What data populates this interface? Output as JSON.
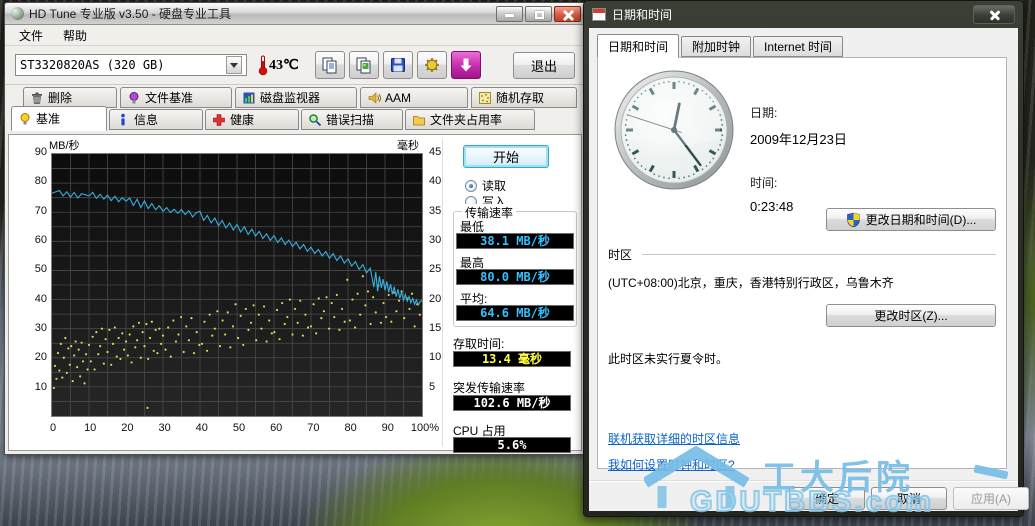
{
  "hdtune": {
    "title": "HD Tune 专业版 v3.50 - 硬盘专业工具",
    "menu": [
      "文件",
      "帮助"
    ],
    "drive_select": "ST3320820AS (320 GB)",
    "temperature": "43℃",
    "toolbar_icons": [
      "copy-text-icon",
      "copy-image-icon",
      "save-icon",
      "options-icon",
      "download-arrow-icon"
    ],
    "exit_label": "退出",
    "tabs_row1": [
      {
        "label": "删除",
        "icon": "trash-icon"
      },
      {
        "label": "文件基准",
        "icon": "purple-bulb-icon"
      },
      {
        "label": "磁盘监视器",
        "icon": "monitor-chart-icon"
      },
      {
        "label": "AAM",
        "icon": "speaker-icon"
      },
      {
        "label": "随机存取",
        "icon": "random-access-icon"
      }
    ],
    "tabs_row2": [
      {
        "label": "基准",
        "icon": "yellow-bulb-icon",
        "active": true
      },
      {
        "label": "信息",
        "icon": "info-icon"
      },
      {
        "label": "健康",
        "icon": "health-cross-icon"
      },
      {
        "label": "错误扫描",
        "icon": "magnifier-icon"
      },
      {
        "label": "文件夹占用率",
        "icon": "folder-icon"
      }
    ],
    "start_button": "开始",
    "radio_read": "读取",
    "radio_write": "写入",
    "transfer_group": {
      "title": "传输速率",
      "min_label": "最低",
      "min_value": "38.1 MB/秒",
      "max_label": "最高",
      "max_value": "80.0 MB/秒",
      "avg_label": "平均:",
      "avg_value": "64.6 MB/秒"
    },
    "access_label": "存取时间:",
    "access_value": "13.4 毫秒",
    "burst_label": "突发传输速率",
    "burst_value": "102.6 MB/秒",
    "cpu_label": "CPU 占用",
    "cpu_value": "5.6%"
  },
  "chart_data": {
    "type": "line+scatter",
    "ylabel_left": "MB/秒",
    "ylabel_right": "毫秒",
    "ylim_left": [
      0,
      90
    ],
    "ylim_right": [
      0,
      45
    ],
    "xlim": [
      0,
      100
    ],
    "grid": true,
    "y_left_ticks": [
      90,
      80,
      70,
      60,
      50,
      40,
      30,
      20,
      10
    ],
    "y_right_ticks": [
      45,
      40,
      35,
      30,
      25,
      20,
      15,
      10,
      5
    ],
    "x_tick_labels": [
      "0",
      "10",
      "20",
      "30",
      "40",
      "50",
      "60",
      "70",
      "80",
      "90",
      "100%"
    ],
    "line_color": "#3aaede",
    "scatter_color": "#d8d858",
    "series": [
      {
        "name": "transfer_rate_MBps",
        "points": [
          [
            0,
            76.5
          ],
          [
            2,
            77.5
          ],
          [
            3,
            75.6
          ],
          [
            4,
            77.0
          ],
          [
            5,
            75.2
          ],
          [
            6,
            76.8
          ],
          [
            7,
            74.9
          ],
          [
            8,
            76.4
          ],
          [
            10,
            75.6
          ],
          [
            11,
            76.8
          ],
          [
            12,
            74.8
          ],
          [
            13,
            76.2
          ],
          [
            14,
            74.5
          ],
          [
            15,
            75.9
          ],
          [
            16,
            74.0
          ],
          [
            17,
            75.5
          ],
          [
            18,
            73.6
          ],
          [
            19,
            75.0
          ],
          [
            20,
            73.8
          ],
          [
            21,
            74.9
          ],
          [
            22,
            72.3
          ],
          [
            23,
            74.5
          ],
          [
            24,
            71.6
          ],
          [
            25,
            73.9
          ],
          [
            26,
            71.2
          ],
          [
            27,
            73.0
          ],
          [
            28,
            70.8
          ],
          [
            29,
            72.2
          ],
          [
            30,
            70.3
          ],
          [
            31,
            71.6
          ],
          [
            32,
            69.9
          ],
          [
            33,
            71.0
          ],
          [
            34,
            69.6
          ],
          [
            35,
            70.9
          ],
          [
            36,
            69.2
          ],
          [
            37,
            70.5
          ],
          [
            38,
            68.4
          ],
          [
            39,
            69.9
          ],
          [
            40,
            70.3
          ],
          [
            41,
            67.2
          ],
          [
            42,
            68.9
          ],
          [
            43,
            66.3
          ],
          [
            44,
            68.0
          ],
          [
            45,
            65.4
          ],
          [
            46,
            67.2
          ],
          [
            47,
            64.6
          ],
          [
            48,
            66.3
          ],
          [
            49,
            63.9
          ],
          [
            50,
            65.8
          ],
          [
            51,
            63.2
          ],
          [
            52,
            65.0
          ],
          [
            53,
            62.4
          ],
          [
            54,
            64.2
          ],
          [
            55,
            61.8
          ],
          [
            56,
            63.4
          ],
          [
            57,
            61.0
          ],
          [
            58,
            62.6
          ],
          [
            59,
            60.3
          ],
          [
            60,
            62.0
          ],
          [
            61,
            59.6
          ],
          [
            62,
            61.2
          ],
          [
            63,
            58.9
          ],
          [
            64,
            60.4
          ],
          [
            65,
            58.2
          ],
          [
            66,
            59.7
          ],
          [
            67,
            57.4
          ],
          [
            68,
            58.9
          ],
          [
            69,
            56.6
          ],
          [
            70,
            58.0
          ],
          [
            71,
            55.8
          ],
          [
            72,
            57.2
          ],
          [
            73,
            55.0
          ],
          [
            74,
            56.5
          ],
          [
            75,
            54.2
          ],
          [
            76,
            55.8
          ],
          [
            77,
            53.4
          ],
          [
            78,
            55.0
          ],
          [
            79,
            52.5
          ],
          [
            80,
            54.0
          ],
          [
            81,
            51.5
          ],
          [
            82,
            53.0
          ],
          [
            83,
            50.4
          ],
          [
            84,
            52.0
          ],
          [
            85,
            49.2
          ],
          [
            86,
            50.8
          ],
          [
            87,
            44.3
          ],
          [
            87.5,
            49.5
          ],
          [
            88,
            42.8
          ],
          [
            88.5,
            48.0
          ],
          [
            89,
            44.0
          ],
          [
            89.5,
            47.0
          ],
          [
            90,
            43.2
          ],
          [
            90.5,
            46.2
          ],
          [
            91,
            42.5
          ],
          [
            91.5,
            45.3
          ],
          [
            92,
            41.8
          ],
          [
            92.5,
            44.4
          ],
          [
            93,
            41.0
          ],
          [
            93.5,
            43.5
          ],
          [
            94,
            40.4
          ],
          [
            94.5,
            42.6
          ],
          [
            95,
            39.8
          ],
          [
            95.5,
            41.8
          ],
          [
            96,
            39.4
          ],
          [
            96.5,
            41.0
          ],
          [
            97,
            38.9
          ],
          [
            97.5,
            40.4
          ],
          [
            98,
            38.4
          ],
          [
            98.5,
            39.9
          ],
          [
            99,
            38.1
          ],
          [
            99.5,
            39.3
          ],
          [
            100,
            39.6
          ]
        ]
      },
      {
        "name": "access_time_ms",
        "points": [
          [
            0.5,
            4.8
          ],
          [
            0.8,
            8.6
          ],
          [
            1.2,
            6.4
          ],
          [
            1.6,
            10.8
          ],
          [
            2.0,
            7.8
          ],
          [
            2.4,
            12.4
          ],
          [
            2.8,
            6.6
          ],
          [
            3.2,
            10.0
          ],
          [
            3.6,
            13.4
          ],
          [
            4.0,
            7.4
          ],
          [
            4.4,
            11.6
          ],
          [
            4.8,
            8.8
          ],
          [
            5.2,
            12.0
          ],
          [
            5.6,
            6.0
          ],
          [
            6.0,
            10.4
          ],
          [
            6.4,
            12.8
          ],
          [
            6.8,
            8.4
          ],
          [
            7.2,
            11.4
          ],
          [
            7.6,
            6.8
          ],
          [
            8.0,
            12.6
          ],
          [
            8.4,
            9.4
          ],
          [
            8.8,
            5.6
          ],
          [
            9.2,
            10.6
          ],
          [
            9.6,
            8.0
          ],
          [
            10.0,
            12.2
          ],
          [
            10.5,
            9.4
          ],
          [
            11.0,
            13.6
          ],
          [
            11.5,
            8.0
          ],
          [
            12.0,
            14.4
          ],
          [
            12.5,
            10.6
          ],
          [
            13.0,
            12.0
          ],
          [
            13.5,
            15.0
          ],
          [
            14.0,
            9.0
          ],
          [
            14.5,
            13.2
          ],
          [
            15.0,
            11.0
          ],
          [
            15.5,
            14.8
          ],
          [
            16.0,
            8.8
          ],
          [
            16.5,
            12.4
          ],
          [
            17.0,
            15.2
          ],
          [
            17.5,
            10.2
          ],
          [
            18.0,
            13.4
          ],
          [
            18.5,
            9.8
          ],
          [
            19.0,
            14.2
          ],
          [
            19.5,
            11.4
          ],
          [
            20.0,
            12.8
          ],
          [
            20.5,
            10.4
          ],
          [
            21.0,
            14.0
          ],
          [
            21.5,
            9.2
          ],
          [
            22.0,
            15.4
          ],
          [
            22.5,
            11.8
          ],
          [
            23.0,
            13.0
          ],
          [
            23.5,
            16.0
          ],
          [
            24.0,
            10.0
          ],
          [
            24.5,
            14.4
          ],
          [
            25.0,
            12.0
          ],
          [
            25.5,
            15.8
          ],
          [
            25.8,
            1.4
          ],
          [
            26.0,
            9.8
          ],
          [
            26.5,
            13.4
          ],
          [
            27.0,
            16.2
          ],
          [
            27.5,
            11.2
          ],
          [
            28.0,
            14.8
          ],
          [
            28.5,
            10.8
          ],
          [
            29.0,
            15.0
          ],
          [
            29.5,
            12.4
          ],
          [
            30.0,
            13.8
          ],
          [
            30.7,
            11.4
          ],
          [
            31.4,
            15.2
          ],
          [
            32.1,
            10.2
          ],
          [
            32.8,
            16.4
          ],
          [
            33.5,
            12.8
          ],
          [
            34.2,
            14.0
          ],
          [
            34.9,
            17.0
          ],
          [
            35.6,
            11.0
          ],
          [
            36.3,
            15.4
          ],
          [
            37.0,
            13.0
          ],
          [
            37.7,
            16.8
          ],
          [
            38.4,
            10.8
          ],
          [
            39.1,
            14.4
          ],
          [
            39.8,
            12.2
          ],
          [
            40.5,
            12.4
          ],
          [
            41.2,
            16.2
          ],
          [
            41.9,
            11.2
          ],
          [
            42.6,
            17.4
          ],
          [
            43.3,
            13.8
          ],
          [
            44.0,
            15.0
          ],
          [
            44.7,
            18.0
          ],
          [
            45.4,
            12.0
          ],
          [
            46.1,
            16.4
          ],
          [
            46.8,
            14.0
          ],
          [
            47.5,
            17.8
          ],
          [
            48.2,
            11.8
          ],
          [
            48.9,
            15.4
          ],
          [
            49.6,
            19.2
          ],
          [
            50.3,
            13.4
          ],
          [
            51.0,
            17.2
          ],
          [
            51.7,
            12.2
          ],
          [
            52.4,
            18.4
          ],
          [
            53.1,
            14.8
          ],
          [
            53.8,
            16.0
          ],
          [
            54.5,
            19.0
          ],
          [
            55.2,
            13.0
          ],
          [
            55.9,
            17.4
          ],
          [
            56.6,
            15.0
          ],
          [
            57.3,
            18.8
          ],
          [
            58.0,
            12.8
          ],
          [
            58.7,
            16.4
          ],
          [
            59.4,
            14.2
          ],
          [
            60.1,
            14.4
          ],
          [
            60.8,
            18.2
          ],
          [
            61.5,
            13.2
          ],
          [
            62.2,
            19.4
          ],
          [
            62.9,
            15.8
          ],
          [
            63.6,
            17.0
          ],
          [
            64.3,
            20.0
          ],
          [
            65.0,
            14.0
          ],
          [
            65.7,
            18.4
          ],
          [
            66.4,
            16.0
          ],
          [
            67.1,
            19.8
          ],
          [
            67.8,
            13.8
          ],
          [
            68.5,
            17.4
          ],
          [
            69.2,
            15.2
          ],
          [
            70.0,
            15.4
          ],
          [
            70.7,
            19.2
          ],
          [
            71.4,
            14.2
          ],
          [
            72.1,
            20.2
          ],
          [
            72.8,
            16.8
          ],
          [
            73.5,
            18.0
          ],
          [
            74.2,
            20.4
          ],
          [
            74.9,
            15.0
          ],
          [
            75.6,
            19.4
          ],
          [
            76.3,
            17.0
          ],
          [
            77.0,
            20.8
          ],
          [
            77.7,
            14.8
          ],
          [
            78.4,
            18.4
          ],
          [
            79.1,
            16.2
          ],
          [
            79.8,
            23.4
          ],
          [
            80.5,
            16.4
          ],
          [
            81.2,
            20.0
          ],
          [
            81.9,
            15.2
          ],
          [
            82.6,
            21.0
          ],
          [
            83.3,
            17.4
          ],
          [
            84.0,
            24.0
          ],
          [
            84.7,
            19.0
          ],
          [
            85.4,
            21.4
          ],
          [
            86.1,
            15.8
          ],
          [
            86.8,
            20.4
          ],
          [
            87.5,
            17.8
          ],
          [
            88.2,
            22.4
          ],
          [
            88.9,
            16.0
          ],
          [
            89.6,
            19.4
          ],
          [
            90.3,
            17.0
          ],
          [
            91.0,
            20.8
          ],
          [
            91.7,
            16.2
          ],
          [
            92.4,
            21.2
          ],
          [
            93.1,
            18.0
          ],
          [
            93.8,
            19.8
          ],
          [
            94.5,
            21.4
          ],
          [
            95.2,
            16.8
          ],
          [
            95.9,
            20.2
          ],
          [
            96.6,
            18.4
          ],
          [
            97.3,
            21.0
          ],
          [
            98.0,
            15.4
          ],
          [
            98.7,
            19.2
          ],
          [
            99.4,
            17.4
          ]
        ]
      }
    ]
  },
  "datetime_dialog": {
    "title": "日期和时间",
    "tabs": [
      "日期和时间",
      "附加时钟",
      "Internet 时间"
    ],
    "date_label": "日期:",
    "date_value": "2009年12月23日",
    "time_label": "时间:",
    "time_value": "0:23:48",
    "change_datetime_button": "更改日期和时间(D)...",
    "timezone_section": "时区",
    "timezone_value": "(UTC+08:00)北京，重庆，香港特别行政区，乌鲁木齐",
    "change_timezone_button": "更改时区(Z)...",
    "dst_note": "此时区未实行夏令时。",
    "link_online_info": "联机获取详细的时区信息",
    "link_how_to": "我如何设置时钟和时区?",
    "ok_button": "确定",
    "cancel_button": "取消",
    "apply_button": "应用(A)",
    "clock": {
      "hour_angle": 11.5,
      "minute_angle": 143,
      "second_angle": 288
    }
  },
  "watermark": {
    "text": "工大后院",
    "url": "GDUTBBS.com"
  }
}
